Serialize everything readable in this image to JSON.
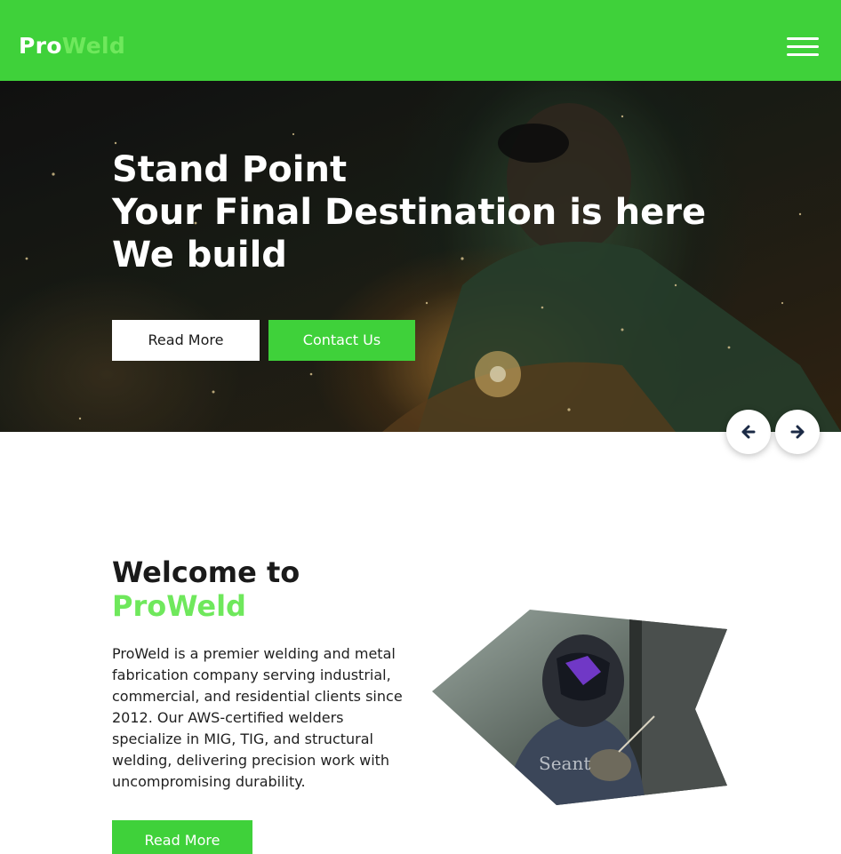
{
  "brand": {
    "part1": "Pro",
    "part2": "Weld"
  },
  "hero": {
    "line1": "Stand Point",
    "line2": "Your Final Destination is here",
    "line3": "We build",
    "read_more_label": "Read More",
    "contact_label": "Contact Us"
  },
  "about": {
    "heading_line1": "Welcome to",
    "heading_line2": "ProWeld",
    "body": "ProWeld is a premier welding and metal fabrication company serving industrial, commercial, and residential clients since 2012. Our AWS-certified welders specialize in MIG, TIG, and structural welding, delivering precision work with uncompromising durability.",
    "read_more_label": "Read More"
  },
  "icons": {
    "menu": "hamburger-menu-icon",
    "prev": "arrow-left-icon",
    "next": "arrow-right-icon"
  },
  "colors": {
    "brand_green": "#3fd13a",
    "accent_light_green": "#6fe85c",
    "text_dark": "#1a1a1a"
  }
}
